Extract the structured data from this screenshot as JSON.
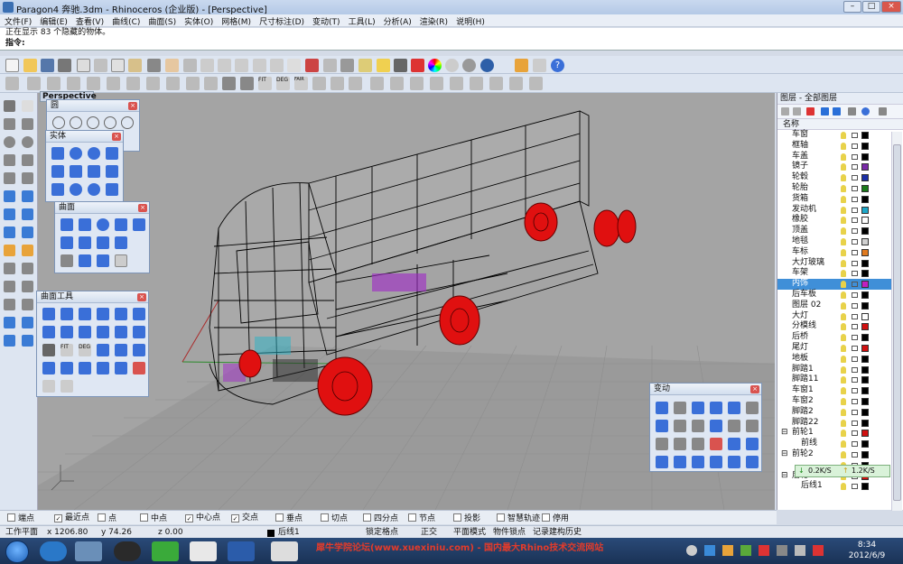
{
  "window": {
    "title": "Paragon4 奔驰.3dm - Rhinoceros (企业版) - [Perspective]"
  },
  "menu": [
    "文件(F)",
    "编辑(E)",
    "查看(V)",
    "曲线(C)",
    "曲面(S)",
    "实体(O)",
    "网格(M)",
    "尺寸标注(D)",
    "变动(T)",
    "工具(L)",
    "分析(A)",
    "渲染(R)",
    "说明(H)"
  ],
  "command": {
    "history": "正在显示 83 个隐藏的物体。",
    "prompt": "指令:"
  },
  "viewport": {
    "label": "Perspective"
  },
  "panels": {
    "circle": {
      "title": "圆"
    },
    "solid": {
      "title": "实体"
    },
    "surface": {
      "title": "曲面"
    },
    "surface_tools": {
      "title": "曲面工具"
    },
    "transform": {
      "title": "变动"
    }
  },
  "layers": {
    "title": "图层 - 全部图层",
    "column": "名称",
    "rows": [
      {
        "name": "车窗",
        "color": "#000000"
      },
      {
        "name": "框轴",
        "color": "#000000"
      },
      {
        "name": "车盖",
        "color": "#000000"
      },
      {
        "name": "镜子",
        "color": "#7a2aa8"
      },
      {
        "name": "轮毂",
        "color": "#1b2fa6"
      },
      {
        "name": "轮胎",
        "color": "#1a7a1a"
      },
      {
        "name": "货箱",
        "color": "#000000"
      },
      {
        "name": "发动机",
        "color": "#1fa8c9"
      },
      {
        "name": "橡胶",
        "color": "#ffffff"
      },
      {
        "name": "顶盖",
        "color": "#000000"
      },
      {
        "name": "地毯",
        "color": "#d0d0d0"
      },
      {
        "name": "车标",
        "color": "#e07a1f"
      },
      {
        "name": "大灯玻璃",
        "color": "#000000"
      },
      {
        "name": "车架",
        "color": "#000000"
      },
      {
        "name": "内饰",
        "color": "#c020c0",
        "selected": true
      },
      {
        "name": "后车板",
        "color": "#000000"
      },
      {
        "name": "图层 02",
        "color": "#000000"
      },
      {
        "name": "大灯",
        "color": "#ffffff"
      },
      {
        "name": "分模线",
        "color": "#d01010"
      },
      {
        "name": "后桥",
        "color": "#000000"
      },
      {
        "name": "尾灯",
        "color": "#d01010"
      },
      {
        "name": "地板",
        "color": "#000000"
      },
      {
        "name": "脚踏1",
        "color": "#000000"
      },
      {
        "name": "脚踏11",
        "color": "#000000"
      },
      {
        "name": "车窗1",
        "color": "#000000"
      },
      {
        "name": "车窗2",
        "color": "#000000"
      },
      {
        "name": "脚踏2",
        "color": "#000000"
      },
      {
        "name": "脚踏22",
        "color": "#000000"
      },
      {
        "name": "前轮1",
        "color": "#d01010",
        "expander": "⊟"
      },
      {
        "name": "前线",
        "color": "#000000",
        "indent": true
      },
      {
        "name": "前轮2",
        "color": "#000000",
        "expander": "⊟"
      },
      {
        "name": "",
        "color": "#000000"
      },
      {
        "name": "后轮1",
        "color": "#d01010",
        "expander": "⊟"
      },
      {
        "name": "后线1",
        "color": "#000000",
        "indent": true
      }
    ]
  },
  "netspeed": {
    "down": "0.2K/S",
    "up": "1.2K/S"
  },
  "osnap": [
    {
      "label": "端点",
      "checked": false
    },
    {
      "label": "最近点",
      "checked": true
    },
    {
      "label": "点",
      "checked": false
    },
    {
      "label": "中点",
      "checked": false
    },
    {
      "label": "中心点",
      "checked": true
    },
    {
      "label": "交点",
      "checked": true
    },
    {
      "label": "垂点",
      "checked": false
    },
    {
      "label": "切点",
      "checked": false
    },
    {
      "label": "四分点",
      "checked": false
    },
    {
      "label": "节点",
      "checked": false
    },
    {
      "label": "投影",
      "checked": false
    },
    {
      "label": "智慧轨迹",
      "checked": false
    },
    {
      "label": "停用",
      "checked": false
    }
  ],
  "status": {
    "cplane": "工作平面",
    "x": "x 1206.80",
    "y": "y 74.26",
    "z": "z 0.00",
    "layer": "后线1",
    "grid_snap": "锁定格点",
    "ortho": "正交",
    "planar": "平面模式",
    "osnap": "物件锁点",
    "history": "记录建构历史"
  },
  "taskbar": {
    "time": "8:34",
    "date": "2012/6/9",
    "watermark": "犀牛学院论坛(www.xuexiniu.com) - 国内最大Rhino技术交流网站"
  },
  "colors": {
    "accent": "#3f8fd8",
    "wire": "#000000",
    "wheel": "#e01010"
  }
}
